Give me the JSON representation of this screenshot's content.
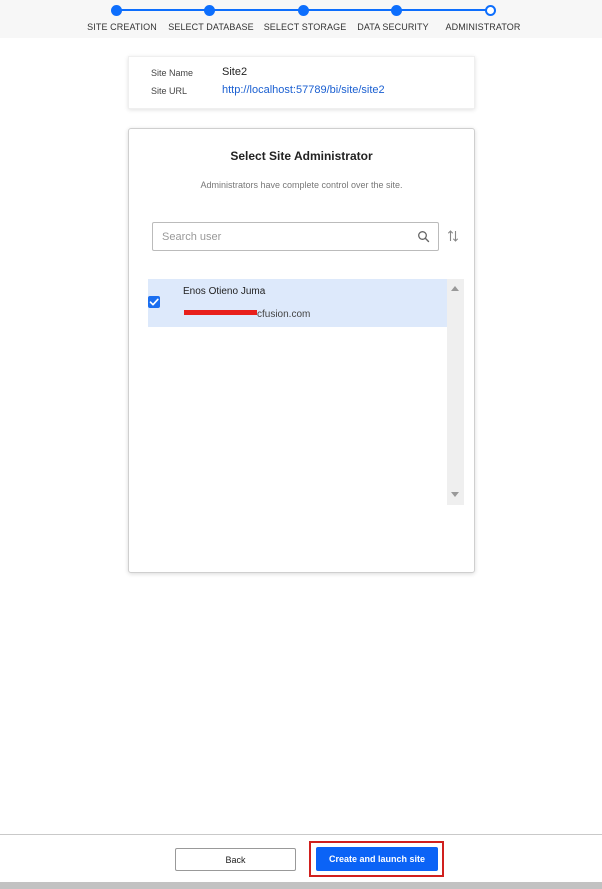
{
  "stepper": {
    "steps": [
      {
        "label": "SITE CREATION"
      },
      {
        "label": "SELECT DATABASE"
      },
      {
        "label": "SELECT STORAGE"
      },
      {
        "label": "DATA SECURITY"
      },
      {
        "label": "ADMINISTRATOR"
      }
    ],
    "accent_color": "#0d6efd"
  },
  "site_info": {
    "name_label": "Site Name",
    "name_value": "Site2",
    "url_label": "Site URL",
    "url_value": "http://localhost:57789/bi/site/site2"
  },
  "admin_panel": {
    "title": "Select Site Administrator",
    "subtitle": "Administrators have complete control over the site.",
    "search_placeholder": "Search user",
    "search_icon": "search-icon",
    "sort_icon": "sort-icon",
    "users": [
      {
        "name": "Enos Otieno Juma",
        "email_visible": "cfusion.com",
        "selected": true
      }
    ]
  },
  "footer": {
    "back_label": "Back",
    "create_label": "Create and launch site",
    "primary_color": "#0b63f6",
    "highlight_color": "#d0201e"
  }
}
